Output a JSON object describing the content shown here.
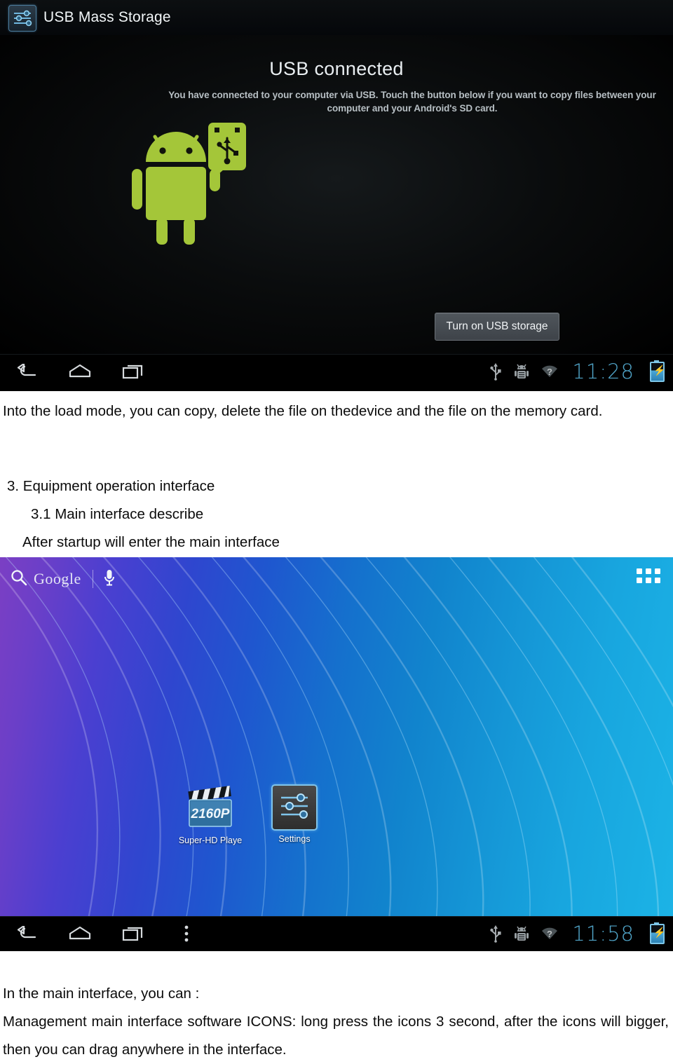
{
  "usb_screenshot": {
    "title_bar": {
      "icon": "settings-sliders-icon",
      "title": "USB Mass Storage"
    },
    "headline": "USB connected",
    "description": "You have connected to your computer via USB. Touch the button below if you want to copy files between your computer and your Android's SD card.",
    "illustration": "android-robot-with-usb-icon",
    "button_label": "Turn on USB storage",
    "navbar": {
      "back": "back-icon",
      "home": "home-icon",
      "recents": "recents-icon",
      "menu": null
    },
    "statusbar": {
      "usb_icon": "usb-icon",
      "debug_icon": "android-debug-icon",
      "wifi_icon": "wifi-unknown-icon",
      "clock": "11:28",
      "battery": "battery-charging-icon"
    }
  },
  "document": {
    "paragraph_top": "Into the load mode, you can copy, delete the file on thedevice and the file on the memory card.",
    "section_heading": "3. Equipment operation interface",
    "section_subheading": "3.1  Main  interface  describe",
    "section_note": "After startup will enter the main interface",
    "paragraph_bottom_line1": "In the main interface, you can :",
    "paragraph_bottom_line2": "Management main interface software ICONS: long press the icons 3 second, after the icons will bigger, then you can drag anywhere in the interface."
  },
  "home_screenshot": {
    "search": {
      "search_icon": "magnifier-icon",
      "brand": "Google",
      "mic_icon": "microphone-icon"
    },
    "apps_button": "apps-grid-icon",
    "apps": [
      {
        "label": "Super-HD Playe",
        "icon": "clapperboard-2160p-icon",
        "badge": "2160P"
      },
      {
        "label": "Settings",
        "icon": "settings-sliders-icon"
      }
    ],
    "navbar": {
      "back": "back-icon",
      "home": "home-icon",
      "recents": "recents-icon",
      "menu": "overflow-menu-icon"
    },
    "statusbar": {
      "usb_icon": "usb-icon",
      "debug_icon": "android-debug-icon",
      "wifi_icon": "wifi-unknown-icon",
      "clock": "11:58",
      "battery": "battery-charging-icon"
    }
  },
  "colors": {
    "android_green": "#a4c639",
    "clock_blue": "#5ab8e0",
    "divider_cyan": "#3f97bd",
    "wallpaper_start": "#7b3fc4",
    "wallpaper_end": "#1cb4e6"
  }
}
